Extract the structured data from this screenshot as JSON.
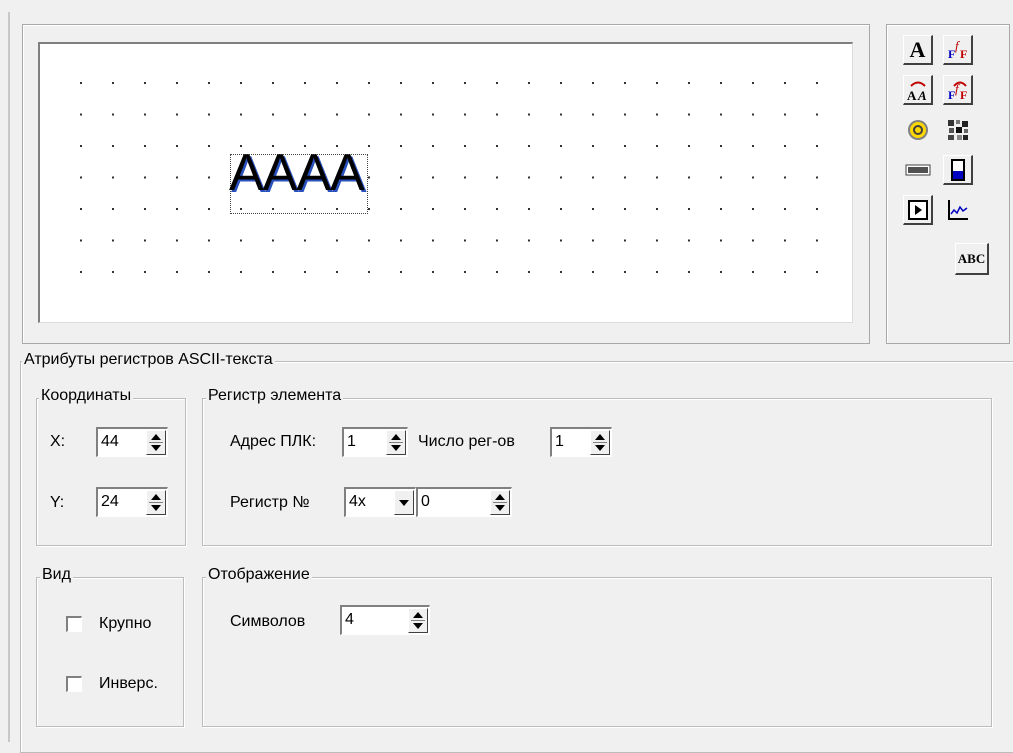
{
  "canvas": {
    "sample_text": "AAAA"
  },
  "toolbox": {
    "buttons": [
      {
        "name": "text-tool-icon",
        "glyph": "A"
      },
      {
        "name": "font-tool-icon",
        "glyph": "F"
      },
      {
        "name": "text-swap-tool-icon",
        "glyph": "ÀÀ"
      },
      {
        "name": "font-swap-tool-icon",
        "glyph": "F"
      },
      {
        "name": "lamp-tool-icon",
        "glyph": "◉"
      },
      {
        "name": "bitmap-tool-icon",
        "glyph": "▦"
      },
      {
        "name": "numeric-display-tool-icon",
        "glyph": "▭"
      },
      {
        "name": "bargraph-tool-icon",
        "glyph": "▯"
      },
      {
        "name": "button-tool-icon",
        "glyph": "▶"
      },
      {
        "name": "trend-tool-icon",
        "glyph": "∿"
      },
      {
        "name": "ascii-tool-icon",
        "glyph": "ABC"
      }
    ]
  },
  "attributes": {
    "title": "Атрибуты регистров ASCII-текста",
    "coords": {
      "title": "Координаты",
      "x_label": "X:",
      "x_value": "44",
      "y_label": "Y:",
      "y_value": "24"
    },
    "register": {
      "title": "Регистр элемента",
      "plc_label": "Адрес ПЛК:",
      "plc_value": "1",
      "count_label": "Число рег-ов",
      "count_value": "1",
      "reg_label": "Регистр №",
      "reg_type": "4x",
      "reg_value": "0"
    },
    "view": {
      "title": "Вид",
      "large_label": "Крупно",
      "large_checked": false,
      "invert_label": "Инверс.",
      "invert_checked": false
    },
    "display": {
      "title": "Отображение",
      "chars_label": "Символов",
      "chars_value": "4"
    }
  }
}
